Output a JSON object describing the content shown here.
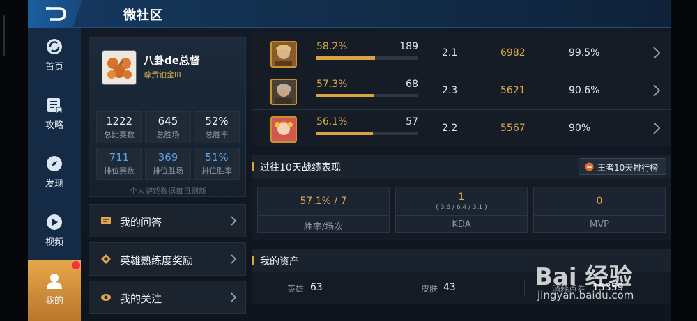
{
  "header": {
    "title": "微社区"
  },
  "sidebar": {
    "items": [
      {
        "label": "首页",
        "icon": "refresh-icon"
      },
      {
        "label": "攻略",
        "icon": "guide-icon"
      },
      {
        "label": "发现",
        "icon": "compass-icon"
      },
      {
        "label": "视频",
        "icon": "play-icon"
      },
      {
        "label": "我的",
        "icon": "user-icon",
        "active": true
      }
    ]
  },
  "profile": {
    "name": "八卦de总督",
    "rank": "尊贵铂金III",
    "stats": [
      {
        "value": "1222",
        "label": "总比赛数"
      },
      {
        "value": "645",
        "label": "总胜场"
      },
      {
        "value": "52%",
        "label": "总胜率"
      },
      {
        "value": "711",
        "label": "排位赛数"
      },
      {
        "value": "369",
        "label": "排位胜场"
      },
      {
        "value": "51%",
        "label": "排位胜率"
      }
    ],
    "note": "个人游戏数据每日刷新"
  },
  "menu": [
    {
      "label": "我的问答",
      "icon": "chat-icon"
    },
    {
      "label": "英雄熟练度奖励",
      "icon": "badge-icon"
    },
    {
      "label": "我的关注",
      "icon": "eye-icon"
    }
  ],
  "heroes": [
    {
      "winrate": "58.2%",
      "fill": 0.582,
      "games": "189",
      "kda": "2.1",
      "score": "6982",
      "pct": "99.5%"
    },
    {
      "winrate": "57.3%",
      "fill": 0.573,
      "games": "68",
      "kda": "2.3",
      "score": "5621",
      "pct": "90.6%"
    },
    {
      "winrate": "56.1%",
      "fill": 0.561,
      "games": "57",
      "kda": "2.2",
      "score": "5567",
      "pct": "90%"
    }
  ],
  "recent": {
    "title": "过往10天战绩表现",
    "rank_button": "王者10天排行榜",
    "boxes": [
      {
        "value": "57.1% / 7",
        "sub": "",
        "label": "胜率/场次"
      },
      {
        "value": "1",
        "sub": "( 3.6 / 6.4 / 3.1 )",
        "label": "KDA"
      },
      {
        "value": "0",
        "sub": "",
        "label": "MVP"
      }
    ]
  },
  "assets": {
    "title": "我的资产",
    "items": [
      {
        "label": "英雄",
        "value": "63"
      },
      {
        "label": "皮肤",
        "value": "43"
      },
      {
        "label": "消耗点券",
        "value": "15359"
      }
    ]
  },
  "watermark": {
    "brand": "Bai 经验",
    "url": "jingyan.baidu.com"
  },
  "colors": {
    "accent_gold": "#d7a343",
    "accent_blue": "#5aa0e8",
    "active_tab": "#e8a64a",
    "header": "#163a63"
  }
}
